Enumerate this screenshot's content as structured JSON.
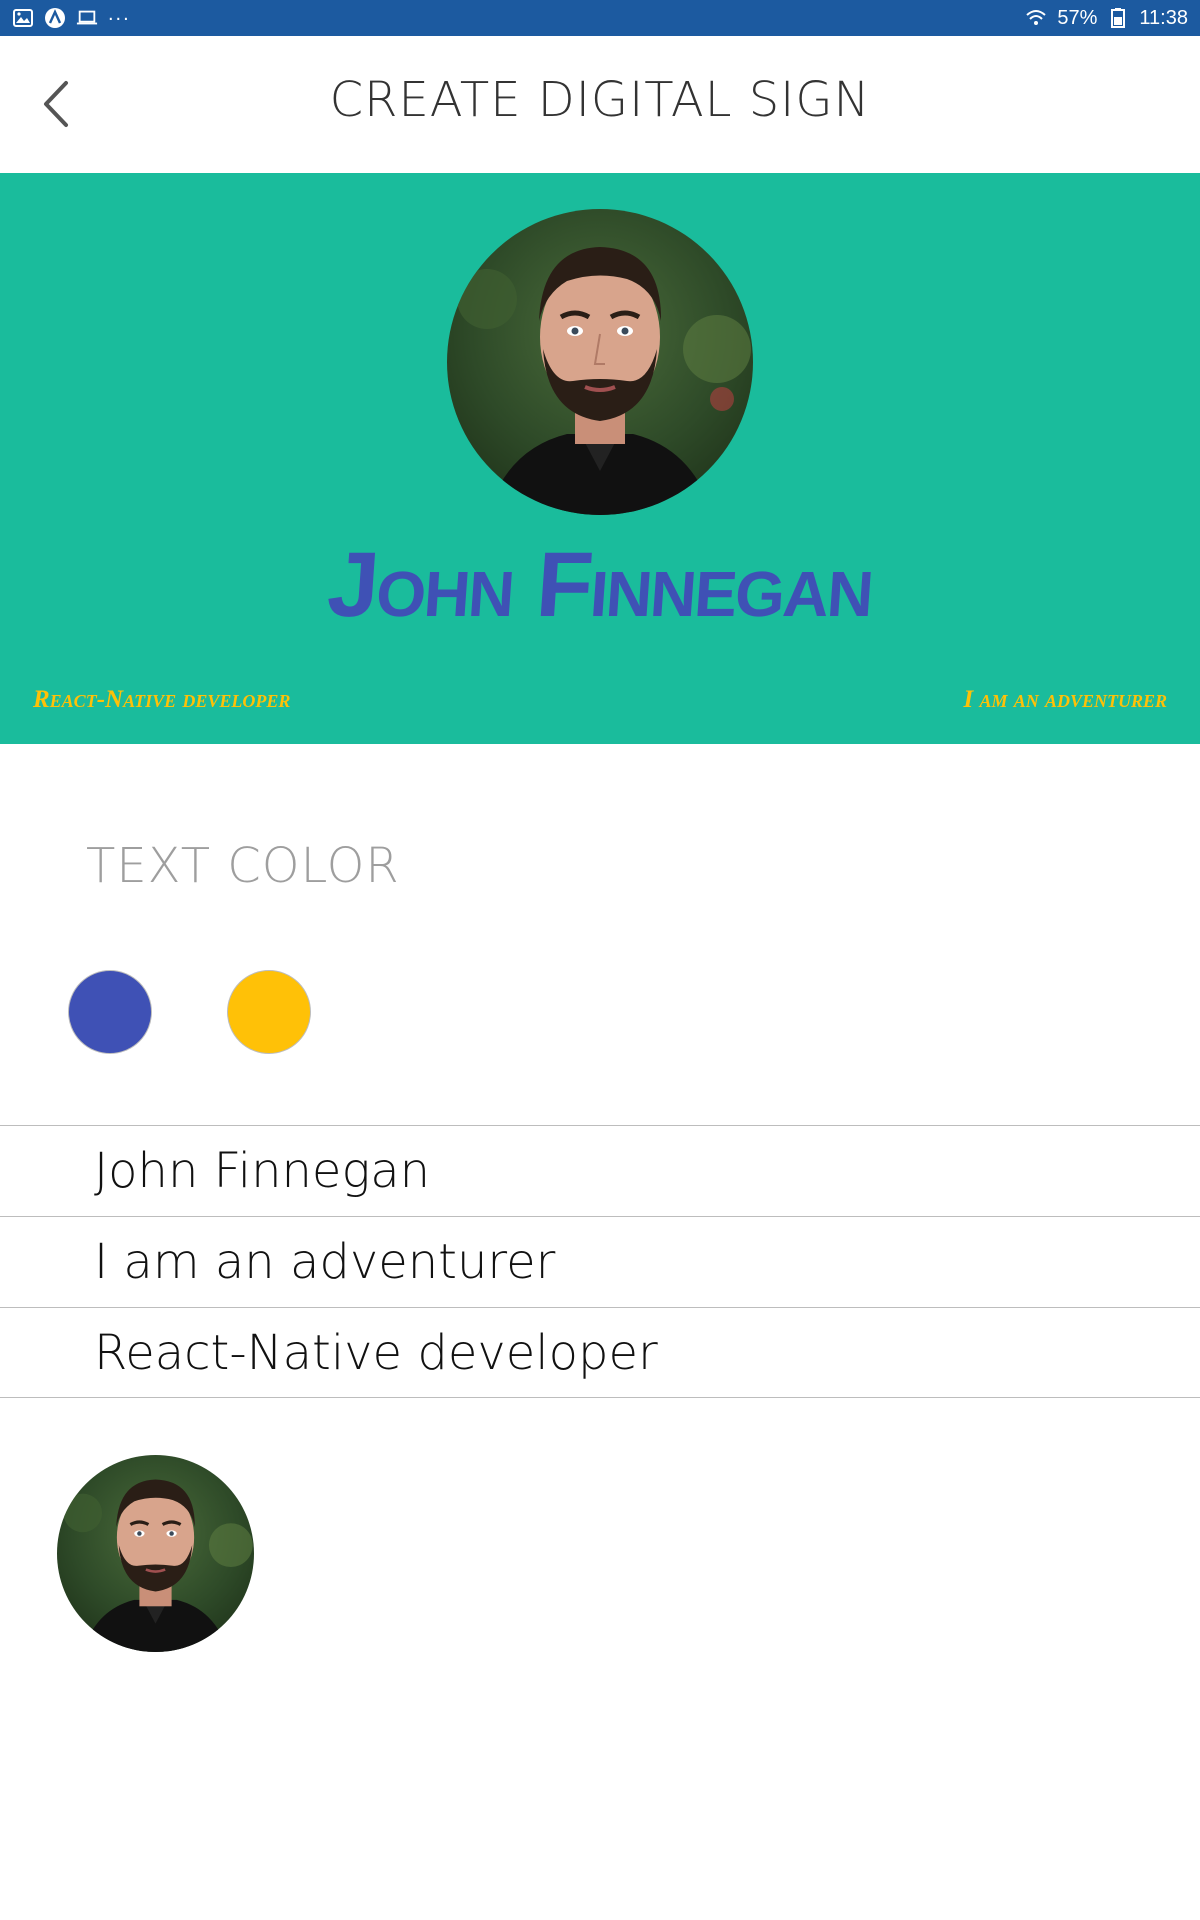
{
  "status_bar": {
    "battery": "57%",
    "time": "11:38",
    "icons": [
      "gallery-icon",
      "app-icon",
      "laptop-icon",
      "more-icon",
      "wifi-icon",
      "battery-icon"
    ]
  },
  "header": {
    "title": "CREATE DIGITAL SIGN",
    "back_icon": "chevron-left-icon"
  },
  "sign": {
    "name": "John Finnegan",
    "role": "React-Native developer",
    "tagline": "I am an adventurer",
    "background_color": "#1abc9c",
    "name_color": "#3f51b5",
    "subtext_color": "#ffc107"
  },
  "text_color": {
    "label": "TEXT COLOR",
    "options": [
      {
        "name": "blue",
        "color": "#3f51b5"
      },
      {
        "name": "yellow",
        "color": "#ffc107"
      }
    ]
  },
  "form": {
    "name_value": "John Finnegan",
    "tagline_value": "I am an adventurer",
    "role_value": "React-Native developer"
  }
}
